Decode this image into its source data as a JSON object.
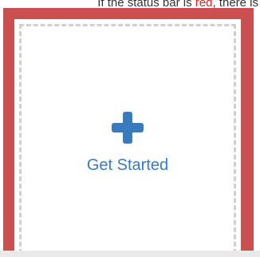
{
  "status_note": {
    "prefix": "If the status bar is ",
    "highlight": "red",
    "suffix": ", there is"
  },
  "dropzone": {
    "label": "Get Started",
    "icon": "plus-icon"
  },
  "colors": {
    "frame": "#c9504f",
    "accent": "#3a7bbd",
    "dash": "#cfcfcf",
    "highlight": "#e02020"
  }
}
